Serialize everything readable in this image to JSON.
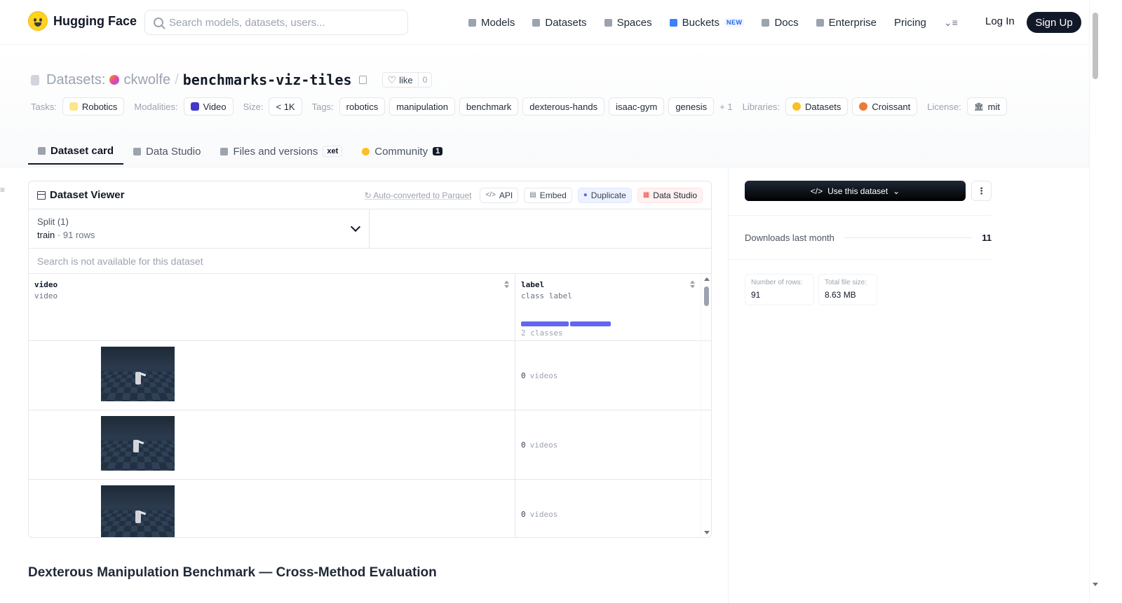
{
  "nav": {
    "brand": "Hugging Face",
    "search_placeholder": "Search models, datasets, users...",
    "links": [
      {
        "label": "Models",
        "icon": "cube-icon"
      },
      {
        "label": "Datasets",
        "icon": "database-icon"
      },
      {
        "label": "Spaces",
        "icon": "grid-icon"
      },
      {
        "label": "Buckets",
        "icon": "bucket-icon",
        "badge": "NEW"
      },
      {
        "label": "Docs",
        "icon": "book-icon"
      },
      {
        "label": "Enterprise",
        "icon": "enterprise-icon"
      },
      {
        "label": "Pricing"
      }
    ],
    "menu_glyph": "⌄≡",
    "login": "Log In",
    "signup": "Sign Up"
  },
  "header": {
    "section": "Datasets:",
    "owner": "ckwolfe",
    "separator": "/",
    "repo": "benchmarks-viz-tiles",
    "like_label": "like",
    "like_count": "0",
    "tasks_label": "Tasks:",
    "task": "Robotics",
    "modalities_label": "Modalities:",
    "modality": "Video",
    "size_label": "Size:",
    "size": "< 1K",
    "tags_label": "Tags:",
    "tags": [
      "robotics",
      "manipulation",
      "benchmark",
      "dexterous-hands",
      "isaac-gym",
      "genesis"
    ],
    "tags_more": "+ 1",
    "libraries_label": "Libraries:",
    "libraries": [
      "Datasets",
      "Croissant"
    ],
    "license_label": "License:",
    "license": "mit"
  },
  "tabs": [
    {
      "label": "Dataset card",
      "active": true
    },
    {
      "label": "Data Studio"
    },
    {
      "label": "Files and versions",
      "badge": "xet"
    },
    {
      "label": "Community",
      "count": "1"
    }
  ],
  "viewer": {
    "title": "Dataset Viewer",
    "auto_converted": "Auto-converted to Parquet",
    "api": "API",
    "embed": "Embed",
    "duplicate": "Duplicate",
    "data_studio": "Data Studio",
    "split_title": "Split (1)",
    "split_name": "train",
    "split_rows": "91 rows",
    "search_unavailable": "Search is not available for this dataset",
    "columns": [
      {
        "name": "video",
        "type": "video"
      },
      {
        "name": "label",
        "type": "class label",
        "summary": "2 classes"
      }
    ],
    "rows": [
      {
        "label_value": "0",
        "label_text": "videos"
      },
      {
        "label_value": "0",
        "label_text": "videos"
      },
      {
        "label_value": "0",
        "label_text": "videos"
      }
    ]
  },
  "readme_title": "Dexterous Manipulation Benchmark — Cross-Method Evaluation",
  "sidebar": {
    "use_button": "Use this dataset",
    "downloads_label": "Downloads last month",
    "downloads_value": "11",
    "rows_label": "Number of rows:",
    "rows_value": "91",
    "size_label": "Total file size:",
    "size_value": "8.63 MB"
  }
}
